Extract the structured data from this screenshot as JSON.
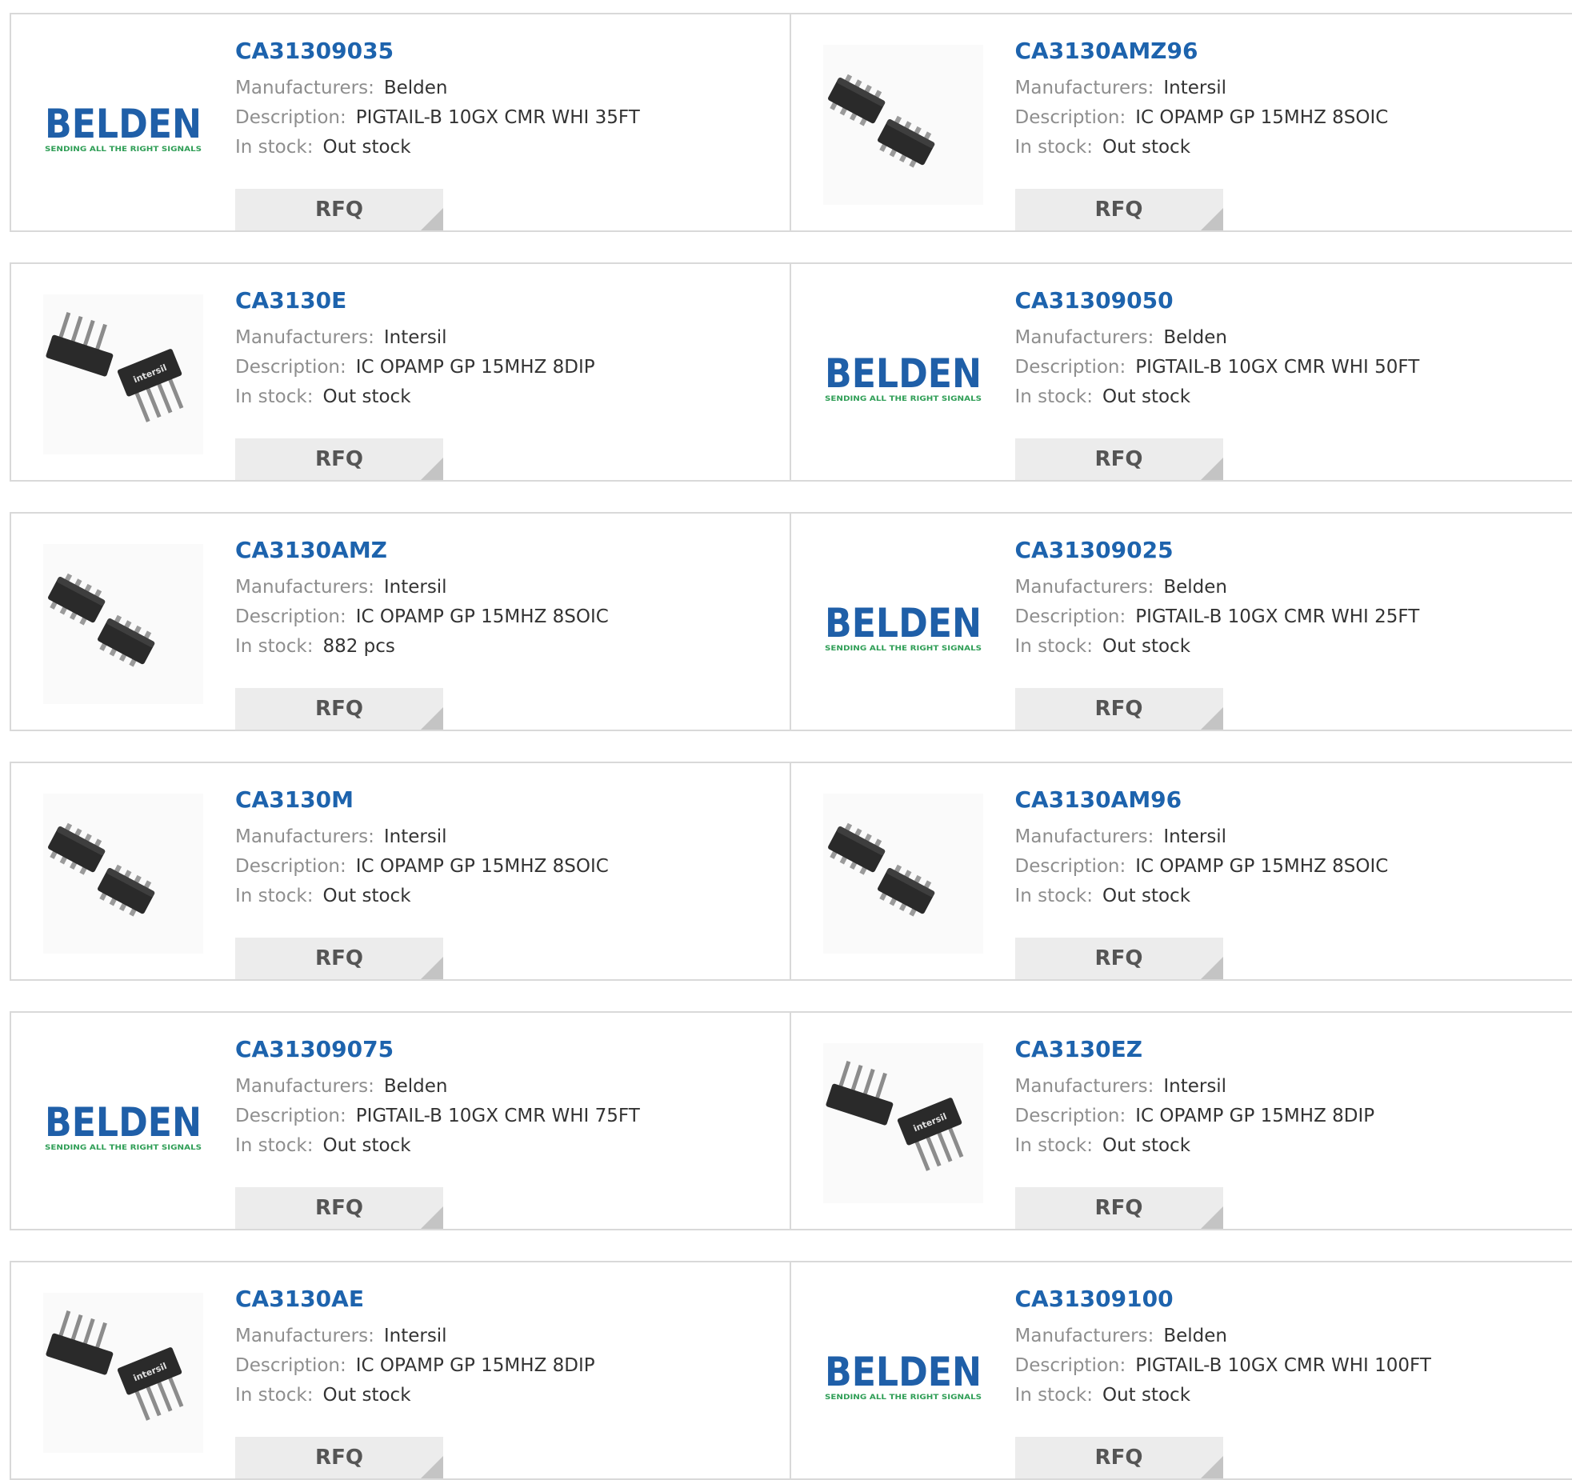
{
  "labels": {
    "manufacturers": "Manufacturers:",
    "description": "Description:",
    "stock": "In stock:",
    "rfq": "RFQ"
  },
  "belden_logo": {
    "word": "BELDEN",
    "tagline": "SENDING ALL THE RIGHT SIGNALS"
  },
  "intersil_logo": {
    "word": "intersil"
  },
  "colors": {
    "link": "#1d63ad",
    "label": "#8e8e8e",
    "value": "#333333",
    "border": "#d9d9d9",
    "button_bg": "#ececec",
    "belden_blue": "#1f5fa8",
    "belden_green": "#2f9e56"
  },
  "products": [
    {
      "part": "CA31309035",
      "manufacturer": "Belden",
      "description": "PIGTAIL-B 10GX CMR WHI 35FT",
      "stock": "Out stock",
      "image": "belden-logo"
    },
    {
      "part": "CA3130AMZ96",
      "manufacturer": "Intersil",
      "description": "IC OPAMP GP 15MHZ 8SOIC",
      "stock": "Out stock",
      "image": "soic-chip"
    },
    {
      "part": "CA3130E",
      "manufacturer": "Intersil",
      "description": "IC OPAMP GP 15MHZ 8DIP",
      "stock": "Out stock",
      "image": "dip-chip"
    },
    {
      "part": "CA31309050",
      "manufacturer": "Belden",
      "description": "PIGTAIL-B 10GX CMR WHI 50FT",
      "stock": "Out stock",
      "image": "belden-logo"
    },
    {
      "part": "CA3130AMZ",
      "manufacturer": "Intersil",
      "description": "IC OPAMP GP 15MHZ 8SOIC",
      "stock": "882 pcs",
      "image": "soic-chip"
    },
    {
      "part": "CA31309025",
      "manufacturer": "Belden",
      "description": "PIGTAIL-B 10GX CMR WHI 25FT",
      "stock": "Out stock",
      "image": "belden-logo"
    },
    {
      "part": "CA3130M",
      "manufacturer": "Intersil",
      "description": "IC OPAMP GP 15MHZ 8SOIC",
      "stock": "Out stock",
      "image": "soic-chip"
    },
    {
      "part": "CA3130AM96",
      "manufacturer": "Intersil",
      "description": "IC OPAMP GP 15MHZ 8SOIC",
      "stock": "Out stock",
      "image": "soic-chip"
    },
    {
      "part": "CA31309075",
      "manufacturer": "Belden",
      "description": "PIGTAIL-B 10GX CMR WHI 75FT",
      "stock": "Out stock",
      "image": "belden-logo"
    },
    {
      "part": "CA3130EZ",
      "manufacturer": "Intersil",
      "description": "IC OPAMP GP 15MHZ 8DIP",
      "stock": "Out stock",
      "image": "dip-chip"
    },
    {
      "part": "CA3130AE",
      "manufacturer": "Intersil",
      "description": "IC OPAMP GP 15MHZ 8DIP",
      "stock": "Out stock",
      "image": "dip-chip"
    },
    {
      "part": "CA31309100",
      "manufacturer": "Belden",
      "description": "PIGTAIL-B 10GX CMR WHI 100FT",
      "stock": "Out stock",
      "image": "belden-logo"
    }
  ]
}
